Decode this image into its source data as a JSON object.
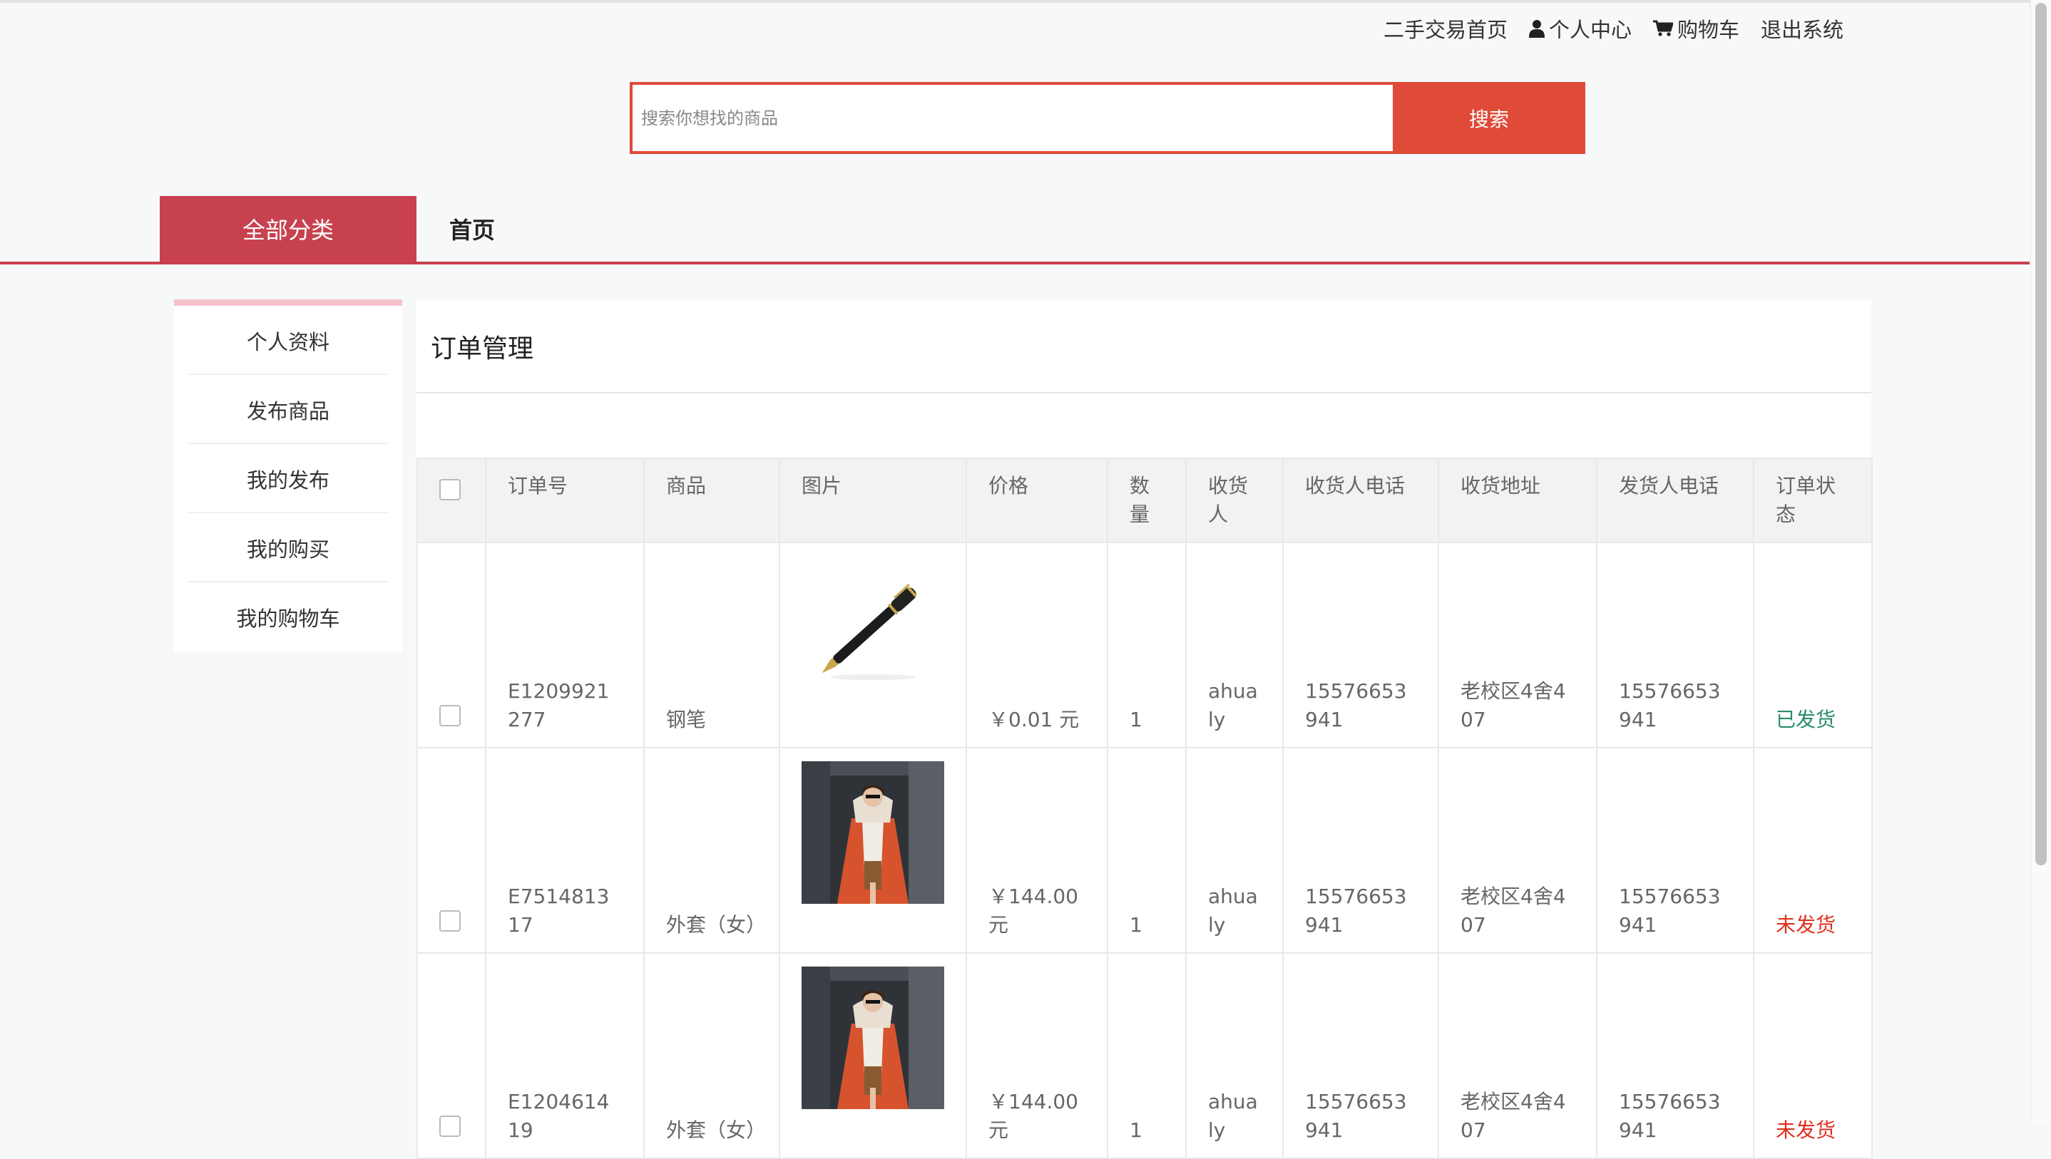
{
  "top_nav": {
    "home": "二手交易首页",
    "profile_center": "个人中心",
    "cart": "购物车",
    "logout": "退出系统"
  },
  "search": {
    "placeholder": "搜索你想找的商品",
    "button": "搜索"
  },
  "category_bar": {
    "all_categories": "全部分类",
    "home": "首页"
  },
  "sidebar": {
    "items": [
      {
        "label": "个人资料"
      },
      {
        "label": "发布商品"
      },
      {
        "label": "我的发布"
      },
      {
        "label": "我的购买"
      },
      {
        "label": "我的购物车"
      }
    ]
  },
  "panel": {
    "title": "订单管理"
  },
  "table": {
    "columns": [
      "",
      "订单号",
      "商品",
      "图片",
      "价格",
      "数量",
      "收货人",
      "收货人电话",
      "收货地址",
      "发货人电话",
      "订单状态"
    ],
    "rows": [
      {
        "order_no": "E1209921277",
        "product": "钢笔",
        "image": "fountain-pen",
        "price": "￥0.01 元",
        "qty": "1",
        "receiver": "ahualy",
        "receiver_phone": "15576653941",
        "address": "老校区4舍407",
        "sender_phone": "15576653941",
        "status": "已发货"
      },
      {
        "order_no": "E751481317",
        "product": "外套（女）",
        "image": "red-coat",
        "price": "￥144.00 元",
        "qty": "1",
        "receiver": "ahualy",
        "receiver_phone": "15576653941",
        "address": "老校区4舍407",
        "sender_phone": "15576653941",
        "status": "未发货"
      },
      {
        "order_no": "E120461419",
        "product": "外套（女）",
        "image": "red-coat",
        "price": "￥144.00 元",
        "qty": "1",
        "receiver": "ahualy",
        "receiver_phone": "15576653941",
        "address": "老校区4舍407",
        "sender_phone": "15576653941",
        "status": "未发货"
      }
    ]
  },
  "colors": {
    "accent_red": "#c8414f",
    "search_red": "#e04a38",
    "status_shipped": "#2a8a6e",
    "status_pending": "#e0301e"
  }
}
